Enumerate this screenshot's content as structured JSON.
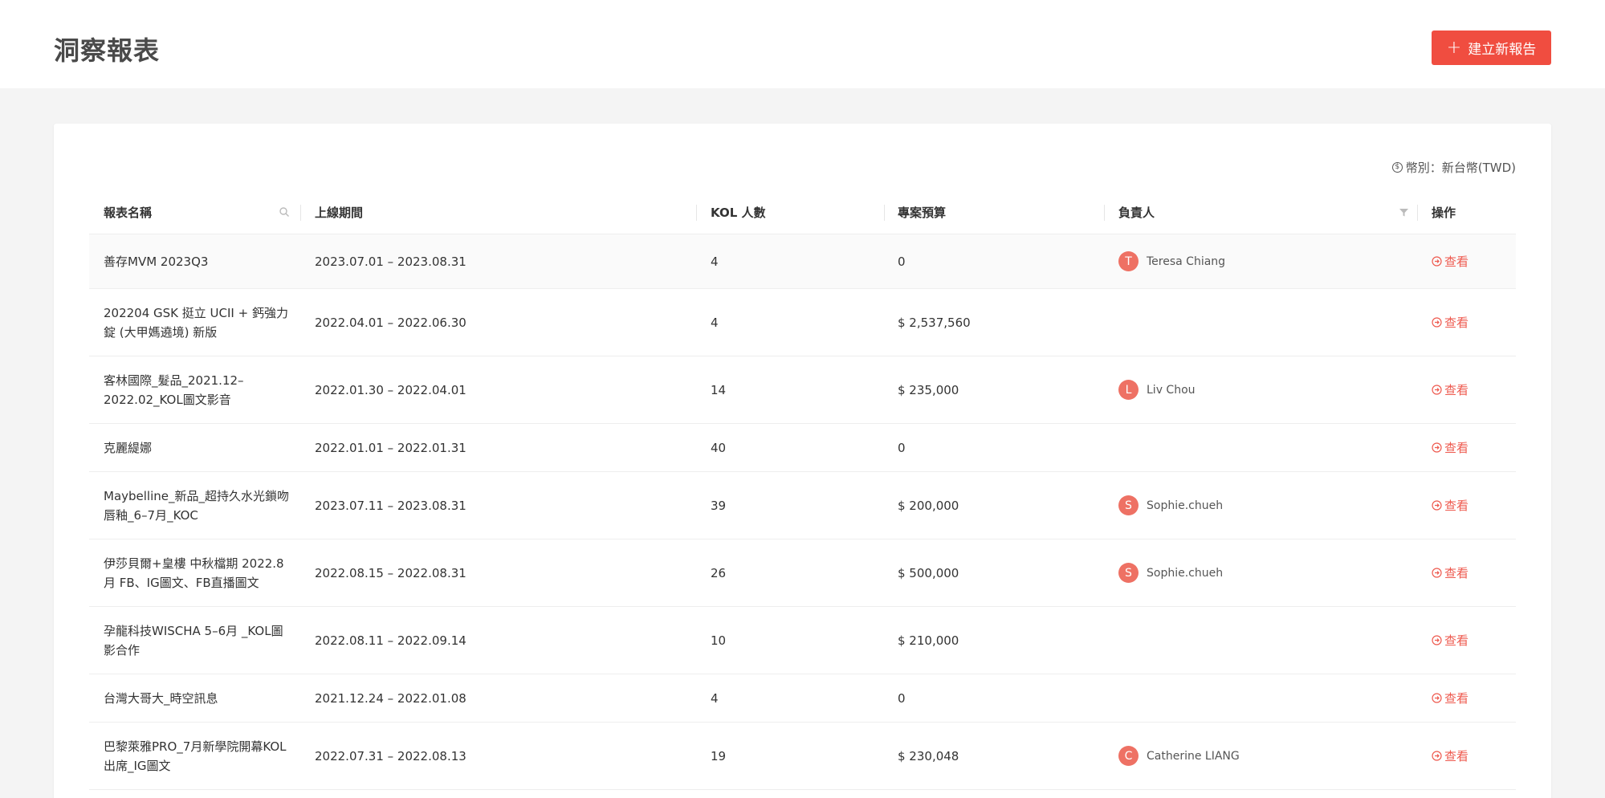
{
  "header": {
    "title": "洞察報表",
    "create_button": {
      "icon": "plus-icon",
      "label": "建立新報告"
    }
  },
  "currency": {
    "icon": "dollar-coin-icon",
    "label": "幣別：新台幣(TWD)"
  },
  "table": {
    "columns": {
      "name": "報表名稱",
      "period": "上線期間",
      "kol": "KOL 人數",
      "budget": "專案預算",
      "owner": "負責人",
      "action": "操作"
    },
    "action_label": "查看",
    "rows": [
      {
        "name": "善存MVM 2023Q3",
        "period": "2023.07.01 – 2023.08.31",
        "kol": "4",
        "budget": "0",
        "owner_initial": "T",
        "owner": "Teresa Chiang"
      },
      {
        "name": "202204 GSK 挺立 UCII + 鈣強力錠 (大甲媽遶境) 新版",
        "period": "2022.04.01 – 2022.06.30",
        "kol": "4",
        "budget": "$ 2,537,560",
        "owner_initial": "",
        "owner": ""
      },
      {
        "name": "客林國際_髮品_2021.12–2022.02_KOL圖文影音",
        "period": "2022.01.30 – 2022.04.01",
        "kol": "14",
        "budget": "$ 235,000",
        "owner_initial": "L",
        "owner": "Liv Chou"
      },
      {
        "name": "克麗緹娜",
        "period": "2022.01.01 – 2022.01.31",
        "kol": "40",
        "budget": "0",
        "owner_initial": "",
        "owner": ""
      },
      {
        "name": "Maybelline_新品_超持久水光鎖吻唇釉_6–7月_KOC",
        "period": "2023.07.11 – 2023.08.31",
        "kol": "39",
        "budget": "$ 200,000",
        "owner_initial": "S",
        "owner": "Sophie.chueh"
      },
      {
        "name": "伊莎貝爾+皇樓 中秋檔期 2022.8月 FB、IG圖文、FB直播圖文",
        "period": "2022.08.15 – 2022.08.31",
        "kol": "26",
        "budget": "$ 500,000",
        "owner_initial": "S",
        "owner": "Sophie.chueh"
      },
      {
        "name": "孕龍科技WISCHA 5–6月 _KOL圖影合作",
        "period": "2022.08.11 – 2022.09.14",
        "kol": "10",
        "budget": "$ 210,000",
        "owner_initial": "",
        "owner": ""
      },
      {
        "name": "台灣大哥大_時空訊息",
        "period": "2021.12.24 – 2022.01.08",
        "kol": "4",
        "budget": "0",
        "owner_initial": "",
        "owner": ""
      },
      {
        "name": "巴黎萊雅PRO_7月新學院開幕KOL出席_IG圖文",
        "period": "2022.07.31 – 2022.08.13",
        "kol": "19",
        "budget": "$ 230,048",
        "owner_initial": "C",
        "owner": "Catherine LIANG"
      }
    ]
  },
  "colors": {
    "accent": "#f04d40",
    "avatar": "#ee7164",
    "link": "#ee5a4f"
  }
}
